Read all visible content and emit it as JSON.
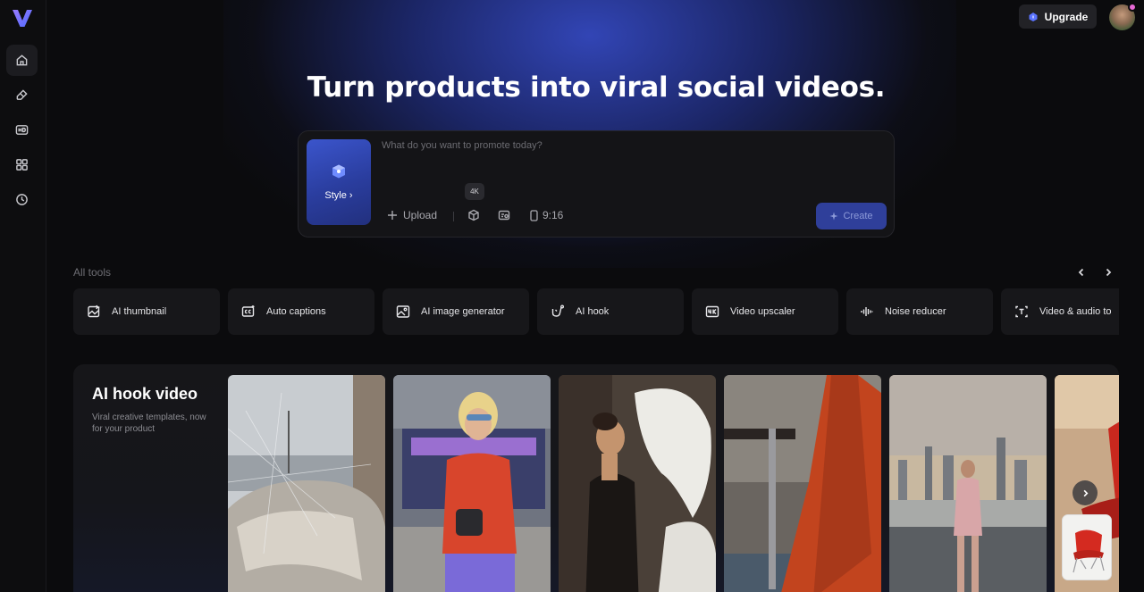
{
  "header": {
    "upgrade_label": "Upgrade"
  },
  "hero": {
    "title": "Turn products into viral social videos."
  },
  "prompt": {
    "placeholder": "What do you want to promote today?",
    "style_label": "Style",
    "tooltip": "4K",
    "upload_label": "Upload",
    "ratio_label": "9:16",
    "create_label": "Create"
  },
  "sidebar": {
    "items": [
      {
        "icon": "home-icon"
      },
      {
        "icon": "eraser-icon"
      },
      {
        "icon": "hd-icon"
      },
      {
        "icon": "grid-icon"
      },
      {
        "icon": "clock-icon"
      }
    ]
  },
  "tools": {
    "label": "All tools",
    "items": [
      {
        "label": "AI thumbnail",
        "icon": "image-sparkle-icon"
      },
      {
        "label": "Auto captions",
        "icon": "captions-icon"
      },
      {
        "label": "AI image generator",
        "icon": "image-icon"
      },
      {
        "label": "AI hook",
        "icon": "hook-icon"
      },
      {
        "label": "Video upscaler",
        "icon": "4k-icon"
      },
      {
        "label": "Noise reducer",
        "icon": "waveform-icon"
      },
      {
        "label": "Video & audio to",
        "icon": "text-icon"
      }
    ]
  },
  "feature": {
    "title": "AI hook video",
    "description": "Viral creative templates, now for your product"
  },
  "colors": {
    "accent": "#3b55cc",
    "background": "#0b0b0d",
    "card": "#17171a"
  }
}
